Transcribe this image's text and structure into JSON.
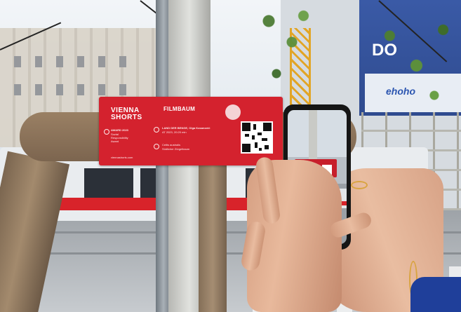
{
  "sign": {
    "logo_line1": "VIENNA",
    "logo_line2": "SHORTS",
    "title": "FILMBAUM",
    "badge": "",
    "award_label": "AWARD 2023",
    "award_detail1": "Sozial",
    "award_detail2": "Responsibility",
    "award_detail3": "Award",
    "film_line1": "LAND DER BENGE, Olga Kosanović",
    "film_line2": "AT 2023, 20:20 min",
    "extra_line1": "Celtis australis",
    "extra_line2": "Südlicher Zürgelbaum",
    "website": "viennashorts.com"
  },
  "billboard": {
    "text": "DO",
    "logo": "ehoho"
  },
  "colors": {
    "sign_red": "#d4222e",
    "tram_stripe": "#d8232a",
    "sleeve_blue": "#1f3f9a"
  }
}
